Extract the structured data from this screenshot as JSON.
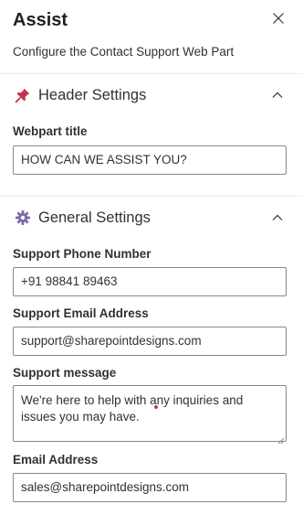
{
  "panel": {
    "title": "Assist",
    "subtitle": "Configure the Contact Support Web Part"
  },
  "sections": {
    "header_settings": {
      "label": "Header Settings",
      "icon": "pushpin-icon",
      "expanded": true,
      "fields": {
        "webpart_title": {
          "label": "Webpart title",
          "value": "HOW CAN WE ASSIST YOU?"
        }
      }
    },
    "general_settings": {
      "label": "General Settings",
      "icon": "gear-icon",
      "expanded": true,
      "fields": {
        "support_phone": {
          "label": "Support Phone Number",
          "value": "+91 98841 89463"
        },
        "support_email": {
          "label": "Support Email Address",
          "value": "support@sharepointdesigns.com"
        },
        "support_message": {
          "label": "Support message",
          "value": "We're here to help with any inquiries and issues you may have."
        },
        "email_address": {
          "label": "Email Address",
          "value": "sales@sharepointdesigns.com"
        }
      }
    }
  },
  "colors": {
    "text": "#323130",
    "border": "#8a8886",
    "divider": "#edebe9",
    "pin": "#c4314b",
    "gear": "#7a6aa8",
    "caret_marker": "#d13438"
  }
}
